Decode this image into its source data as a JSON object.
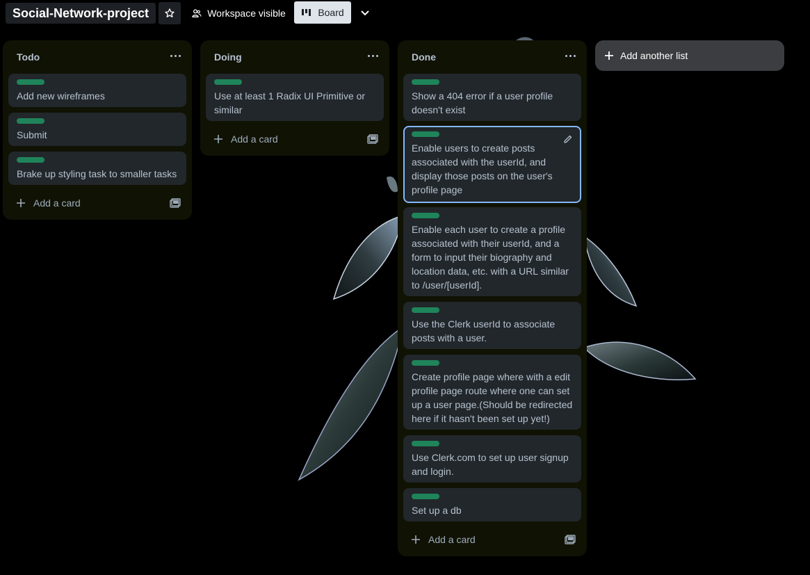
{
  "header": {
    "board_title": "Social-Network-project",
    "workspace_label": "Workspace visible",
    "view_label": "Board"
  },
  "lists": [
    {
      "title": "Todo",
      "cards": [
        {
          "text": "Add new wireframes"
        },
        {
          "text": "Submit"
        },
        {
          "text": "Brake up styling task to smaller tasks"
        }
      ],
      "add_card_label": "Add a card"
    },
    {
      "title": "Doing",
      "cards": [
        {
          "text": "Use at least 1 Radix UI Primitive or similar"
        }
      ],
      "add_card_label": "Add a card"
    },
    {
      "title": "Done",
      "cards": [
        {
          "text": "Show a 404 error if a user profile doesn't exist"
        },
        {
          "text": "Enable users to create posts associated with the userId, and display those posts on the user's profile page",
          "selected": true
        },
        {
          "text": "Enable each user to create a profile associated with their userId, and a form to input their biography and location data, etc. with a URL similar to /user/[userId]."
        },
        {
          "text": "Use the Clerk userId to associate posts with a user."
        },
        {
          "text": "Create profile page where with a edit profile page route where one can set up a user page.(Should be redirected here if it hasn't been set up yet!)"
        },
        {
          "text": "Use Clerk.com to set up user signup and login."
        },
        {
          "text": "Set up a db"
        }
      ],
      "add_card_label": "Add a card"
    }
  ],
  "add_list_label": "Add another list",
  "colors": {
    "label_green": "#1f845a",
    "list_bg": "#101204",
    "card_bg": "#22272b",
    "selected_border": "#85b8ff"
  }
}
